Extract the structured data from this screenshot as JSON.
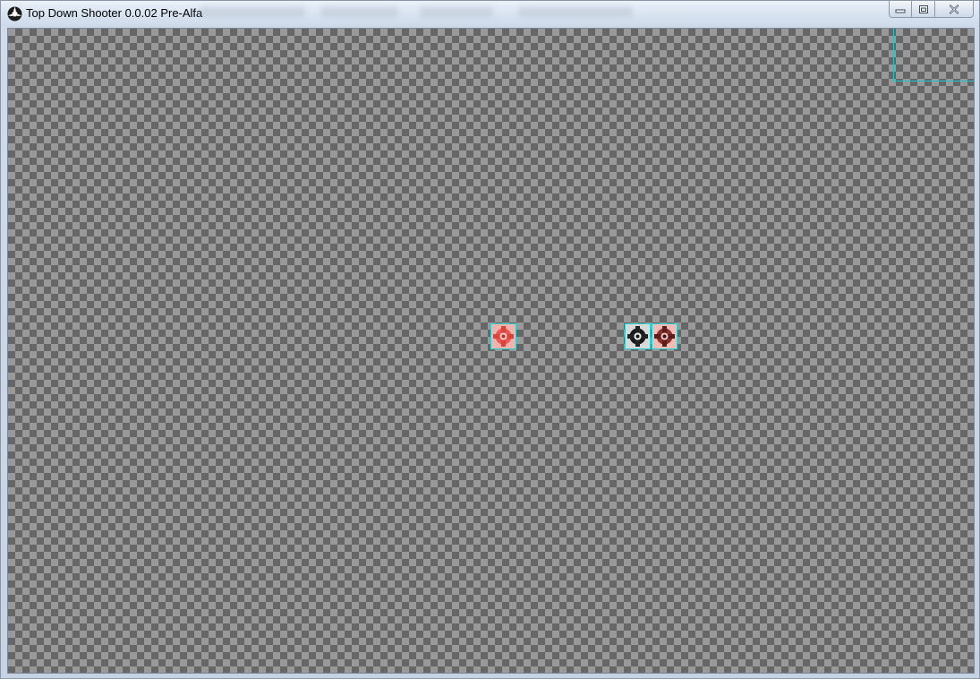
{
  "window": {
    "title": "Top Down Shooter 0.0.02 Pre-Alfa",
    "app_icon": "game-app-icon",
    "controls": {
      "minimize_icon": "minimize-icon",
      "maximize_icon": "restore-icon",
      "close_icon": "close-icon"
    }
  },
  "game": {
    "background": "transparent-checkerboard",
    "colors": {
      "checker_dark": "#666666",
      "checker_light": "#999999",
      "hitbox_outline": "#2bd3d3",
      "enemy_red": "#e8524c",
      "player_black": "#111111"
    },
    "sprites": [
      {
        "name": "enemy-sprite",
        "icon": "red-character-icon"
      },
      {
        "name": "player-sprite",
        "icon": "black-character-icon"
      },
      {
        "name": "enemy-sprite",
        "icon": "red-character-icon"
      }
    ]
  }
}
